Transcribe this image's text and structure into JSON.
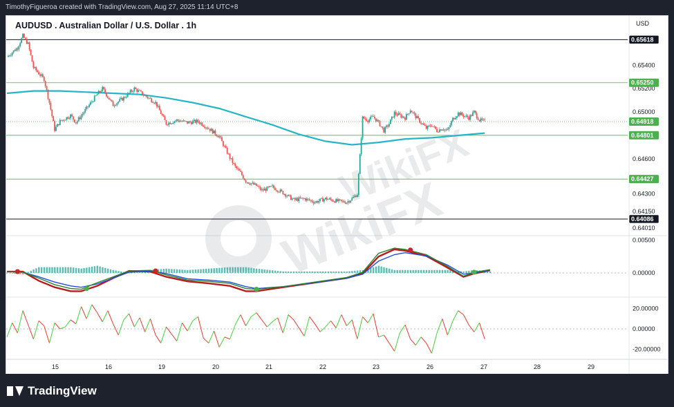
{
  "header": {
    "credit": "TimothyFigueroa created with TradingView.com, Aug 27, 2025 11:14 UTC+8"
  },
  "chart": {
    "title": "AUDUSD . Australian Dollar / U.S. Dollar . 1h",
    "currency": "USD"
  },
  "footer": {
    "brand": "TradingView"
  },
  "watermark": "WikiFX",
  "colors": {
    "up": "#26a69a",
    "down": "#ef5350",
    "ma": "#26b5c6",
    "level_green": "#4caf50",
    "level_black": "#131722",
    "macd_fast": "#2e7d32",
    "macd_signal": "#1e4fd6",
    "macd_slow": "#b71c1c",
    "osc_green": "#43d13c",
    "osc_red": "#e53935"
  },
  "chart_data": [
    {
      "type": "candlestick",
      "title": "AUDUSD . Australian Dollar / U.S. Dollar . 1h",
      "x_ticks": [
        "15",
        "16",
        "19",
        "20",
        "21",
        "22",
        "23",
        "26",
        "27",
        "28",
        "29"
      ],
      "y_ticks": [
        0.654,
        0.652,
        0.65,
        0.646,
        0.643,
        0.6415,
        0.6401
      ],
      "y_tick_labels": [
        "0.65400",
        "0.65200",
        "0.65000",
        "0.64600",
        "0.64300",
        "0.64150",
        "0.64010"
      ],
      "ylim": [
        0.6395,
        0.6575
      ],
      "price_levels": [
        {
          "value": 0.65618,
          "label": "0.65618",
          "style": "black"
        },
        {
          "value": 0.6525,
          "label": "0.65250",
          "style": "green"
        },
        {
          "value": 0.64918,
          "label": "0.64918",
          "style": "green-current"
        },
        {
          "value": 0.64801,
          "label": "0.64801",
          "style": "green"
        },
        {
          "value": 0.64427,
          "label": "0.64427",
          "style": "green"
        },
        {
          "value": 0.64086,
          "label": "0.64086",
          "style": "black"
        }
      ],
      "close_path": [
        [
          0,
          0.6547
        ],
        [
          2,
          0.6555
        ],
        [
          3,
          0.6565
        ],
        [
          4,
          0.6558
        ],
        [
          5,
          0.6538
        ],
        [
          7,
          0.6528
        ],
        [
          8,
          0.6508
        ],
        [
          9,
          0.6485
        ],
        [
          10,
          0.6492
        ],
        [
          12,
          0.6497
        ],
        [
          13,
          0.6491
        ],
        [
          15,
          0.6503
        ],
        [
          17,
          0.6515
        ],
        [
          18,
          0.652
        ],
        [
          20,
          0.6506
        ],
        [
          22,
          0.6512
        ],
        [
          24,
          0.652
        ],
        [
          26,
          0.6514
        ],
        [
          28,
          0.6508
        ],
        [
          30,
          0.649
        ],
        [
          32,
          0.6493
        ],
        [
          34,
          0.6491
        ],
        [
          36,
          0.6492
        ],
        [
          38,
          0.6486
        ],
        [
          40,
          0.6479
        ],
        [
          41,
          0.647
        ],
        [
          42,
          0.6461
        ],
        [
          43,
          0.6453
        ],
        [
          44,
          0.6448
        ],
        [
          45,
          0.6441
        ],
        [
          47,
          0.6437
        ],
        [
          48,
          0.6433
        ],
        [
          50,
          0.6436
        ],
        [
          52,
          0.6431
        ],
        [
          54,
          0.6425
        ],
        [
          56,
          0.6426
        ],
        [
          58,
          0.6423
        ],
        [
          60,
          0.6426
        ],
        [
          62,
          0.6424
        ],
        [
          64,
          0.6423
        ],
        [
          65,
          0.6426
        ],
        [
          66,
          0.643
        ],
        [
          67,
          0.6495
        ],
        [
          68,
          0.6493
        ],
        [
          69,
          0.6496
        ],
        [
          70,
          0.6491
        ],
        [
          71,
          0.6484
        ],
        [
          72,
          0.649
        ],
        [
          73,
          0.6499
        ],
        [
          74,
          0.6497
        ],
        [
          75,
          0.6495
        ],
        [
          76,
          0.6502
        ],
        [
          77,
          0.6496
        ],
        [
          78,
          0.6491
        ],
        [
          79,
          0.6486
        ],
        [
          80,
          0.6489
        ],
        [
          81,
          0.6484
        ],
        [
          82,
          0.6486
        ],
        [
          83,
          0.6484
        ],
        [
          84,
          0.6494
        ],
        [
          85,
          0.6499
        ],
        [
          86,
          0.6497
        ],
        [
          87,
          0.6495
        ],
        [
          88,
          0.65
        ],
        [
          89,
          0.6493
        ],
        [
          90,
          0.6492
        ]
      ],
      "ma_path": [
        [
          0,
          0.6516
        ],
        [
          5,
          0.6518
        ],
        [
          10,
          0.6518
        ],
        [
          15,
          0.6517
        ],
        [
          20,
          0.6516
        ],
        [
          25,
          0.6515
        ],
        [
          30,
          0.6512
        ],
        [
          35,
          0.6508
        ],
        [
          40,
          0.6503
        ],
        [
          45,
          0.6496
        ],
        [
          50,
          0.6489
        ],
        [
          55,
          0.6481
        ],
        [
          60,
          0.6475
        ],
        [
          65,
          0.6472
        ],
        [
          70,
          0.6474
        ],
        [
          75,
          0.6477
        ],
        [
          80,
          0.6478
        ],
        [
          85,
          0.648
        ],
        [
          90,
          0.6482
        ]
      ],
      "x_range": [
        0,
        112
      ]
    },
    {
      "type": "line",
      "indicator": "macd",
      "y_ticks": [
        0.005,
        0.0
      ],
      "y_tick_labels": [
        "0.00500",
        "0.00000"
      ],
      "ylim": [
        -0.0035,
        0.0055
      ],
      "fast": [
        [
          0,
          0.0002
        ],
        [
          3,
          0.0001
        ],
        [
          6,
          -0.0008
        ],
        [
          9,
          -0.0018
        ],
        [
          12,
          -0.0024
        ],
        [
          14,
          -0.0025
        ],
        [
          17,
          -0.0015
        ],
        [
          20,
          -0.0006
        ],
        [
          23,
          0.0003
        ],
        [
          27,
          0.0004
        ],
        [
          30,
          -0.0003
        ],
        [
          34,
          -0.0011
        ],
        [
          38,
          -0.0013
        ],
        [
          42,
          -0.0016
        ],
        [
          45,
          -0.0024
        ],
        [
          47,
          -0.0025
        ],
        [
          52,
          -0.0021
        ],
        [
          58,
          -0.0014
        ],
        [
          64,
          -0.0007
        ],
        [
          67,
          0.0001
        ],
        [
          70,
          0.003
        ],
        [
          73,
          0.0038
        ],
        [
          75,
          0.0036
        ],
        [
          79,
          0.0028
        ],
        [
          83,
          0.001
        ],
        [
          86,
          -0.0005
        ],
        [
          88,
          0.0001
        ],
        [
          91,
          0.0005
        ]
      ],
      "signal": [
        [
          0,
          0.0002
        ],
        [
          3,
          0.0001
        ],
        [
          6,
          -0.0006
        ],
        [
          9,
          -0.0014
        ],
        [
          12,
          -0.002
        ],
        [
          14,
          -0.0022
        ],
        [
          17,
          -0.0017
        ],
        [
          20,
          -0.0008
        ],
        [
          23,
          0.0001
        ],
        [
          27,
          0.0003
        ],
        [
          30,
          -0.0001
        ],
        [
          34,
          -0.0009
        ],
        [
          38,
          -0.0011
        ],
        [
          42,
          -0.0014
        ],
        [
          45,
          -0.0021
        ],
        [
          47,
          -0.0024
        ],
        [
          52,
          -0.0021
        ],
        [
          58,
          -0.0015
        ],
        [
          64,
          -0.0008
        ],
        [
          67,
          -0.0002
        ],
        [
          70,
          0.0018
        ],
        [
          73,
          0.0028
        ],
        [
          75,
          0.0031
        ],
        [
          79,
          0.0026
        ],
        [
          83,
          0.0012
        ],
        [
          86,
          -0.0002
        ],
        [
          88,
          0.0
        ],
        [
          91,
          0.0004
        ]
      ],
      "slow": [
        [
          0,
          0.0002
        ],
        [
          3,
          0.0002
        ],
        [
          6,
          -0.0012
        ],
        [
          9,
          -0.0022
        ],
        [
          12,
          -0.0028
        ],
        [
          14,
          -0.0028
        ],
        [
          17,
          -0.002
        ],
        [
          20,
          -0.0008
        ],
        [
          23,
          0.0003
        ],
        [
          27,
          0.0002
        ],
        [
          30,
          -0.0006
        ],
        [
          34,
          -0.0013
        ],
        [
          38,
          -0.0016
        ],
        [
          42,
          -0.002
        ],
        [
          45,
          -0.0028
        ],
        [
          47,
          -0.0028
        ],
        [
          52,
          -0.0022
        ],
        [
          58,
          -0.0015
        ],
        [
          64,
          -0.0008
        ],
        [
          67,
          -0.0001
        ],
        [
          70,
          0.0025
        ],
        [
          73,
          0.0036
        ],
        [
          75,
          0.0034
        ],
        [
          79,
          0.0026
        ],
        [
          83,
          0.0008
        ],
        [
          86,
          -0.0006
        ],
        [
          88,
          -0.0001
        ],
        [
          91,
          0.0004
        ]
      ],
      "cross_points": [
        {
          "x": 2,
          "y": 0.0002,
          "kind": "bear"
        },
        {
          "x": 15,
          "y": -0.0024,
          "kind": "bull"
        },
        {
          "x": 28,
          "y": 0.0003,
          "kind": "bear"
        },
        {
          "x": 47,
          "y": -0.0025,
          "kind": "bull"
        },
        {
          "x": 76,
          "y": 0.0035,
          "kind": "bear"
        },
        {
          "x": 88,
          "y": 0.0001,
          "kind": "bull"
        }
      ]
    },
    {
      "type": "line",
      "indicator": "oscillator",
      "y_ticks": [
        20,
        0,
        -20
      ],
      "y_tick_labels": [
        "20.00000",
        "0.00000",
        "-20.00000"
      ],
      "ylim": [
        -30,
        30
      ],
      "values": [
        [
          0,
          -8
        ],
        [
          1,
          6
        ],
        [
          2,
          -4
        ],
        [
          3,
          18
        ],
        [
          4,
          4
        ],
        [
          5,
          -10
        ],
        [
          6,
          8
        ],
        [
          7,
          3
        ],
        [
          8,
          -14
        ],
        [
          9,
          6
        ],
        [
          10,
          0
        ],
        [
          11,
          2
        ],
        [
          12,
          9
        ],
        [
          13,
          5
        ],
        [
          14,
          22
        ],
        [
          15,
          10
        ],
        [
          16,
          24
        ],
        [
          17,
          16
        ],
        [
          18,
          7
        ],
        [
          19,
          18
        ],
        [
          20,
          5
        ],
        [
          21,
          -6
        ],
        [
          22,
          9
        ],
        [
          23,
          15
        ],
        [
          24,
          2
        ],
        [
          25,
          11
        ],
        [
          26,
          -3
        ],
        [
          27,
          10
        ],
        [
          28,
          -6
        ],
        [
          29,
          -14
        ],
        [
          30,
          2
        ],
        [
          31,
          -5
        ],
        [
          32,
          -12
        ],
        [
          33,
          6
        ],
        [
          34,
          -2
        ],
        [
          35,
          8
        ],
        [
          36,
          12
        ],
        [
          37,
          -9
        ],
        [
          38,
          -14
        ],
        [
          39,
          -2
        ],
        [
          40,
          -18
        ],
        [
          41,
          -8
        ],
        [
          42,
          -10
        ],
        [
          43,
          4
        ],
        [
          44,
          14
        ],
        [
          45,
          3
        ],
        [
          46,
          12
        ],
        [
          47,
          16
        ],
        [
          48,
          9
        ],
        [
          49,
          2
        ],
        [
          50,
          7
        ],
        [
          51,
          11
        ],
        [
          52,
          -4
        ],
        [
          53,
          14
        ],
        [
          54,
          9
        ],
        [
          55,
          1
        ],
        [
          56,
          -7
        ],
        [
          57,
          12
        ],
        [
          58,
          5
        ],
        [
          59,
          -3
        ],
        [
          60,
          2
        ],
        [
          61,
          8
        ],
        [
          62,
          1
        ],
        [
          63,
          14
        ],
        [
          64,
          3
        ],
        [
          65,
          9
        ],
        [
          66,
          -10
        ],
        [
          67,
          12
        ],
        [
          68,
          6
        ],
        [
          69,
          15
        ],
        [
          70,
          -8
        ],
        [
          71,
          -6
        ],
        [
          72,
          -14
        ],
        [
          73,
          -22
        ],
        [
          74,
          -4
        ],
        [
          75,
          4
        ],
        [
          76,
          -10
        ],
        [
          77,
          -16
        ],
        [
          78,
          -8
        ],
        [
          79,
          -14
        ],
        [
          80,
          -24
        ],
        [
          81,
          -4
        ],
        [
          82,
          10
        ],
        [
          83,
          -6
        ],
        [
          84,
          8
        ],
        [
          85,
          18
        ],
        [
          86,
          14
        ],
        [
          87,
          4
        ],
        [
          88,
          -3
        ],
        [
          89,
          6
        ],
        [
          90,
          -10
        ]
      ]
    }
  ]
}
